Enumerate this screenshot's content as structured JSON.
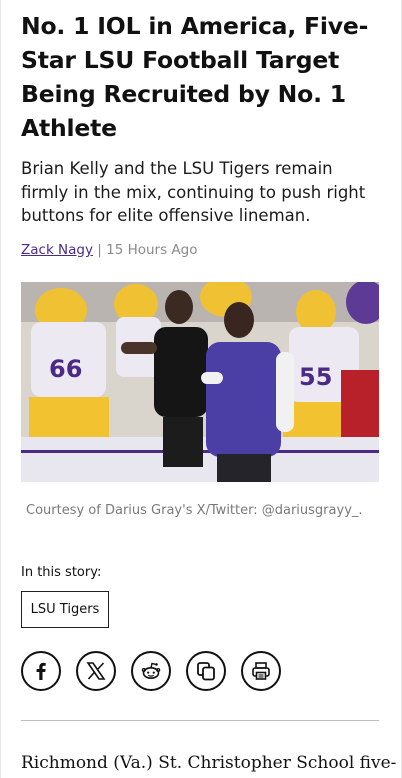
{
  "article": {
    "headline": "No. 1 IOL in America, Five-Star LSU Football Target Being Recruited by No. 1 Athlete",
    "subheadline": "Brian Kelly and the LSU Tigers remain firmly in the mix, continuing to push right buttons for elite offensive lineman.",
    "author": "Zack Nagy",
    "separator": " | ",
    "timestamp": "15 Hours Ago",
    "photo_caption": "Courtesy of Darius Gray's X/Twitter: @dariusgrayy_.",
    "in_this_story_label": "In this story:",
    "tags": [
      "LSU Tigers"
    ],
    "body_start": "Richmond (Va.) St. Christopher School five-"
  },
  "share": {
    "icons": [
      "facebook-icon",
      "x-twitter-icon",
      "reddit-icon",
      "copy-link-icon",
      "print-icon"
    ]
  },
  "colors": {
    "author_link": "#4a2a8a",
    "lsu_purple": "#4b2a86",
    "lsu_gold": "#f2c230"
  }
}
